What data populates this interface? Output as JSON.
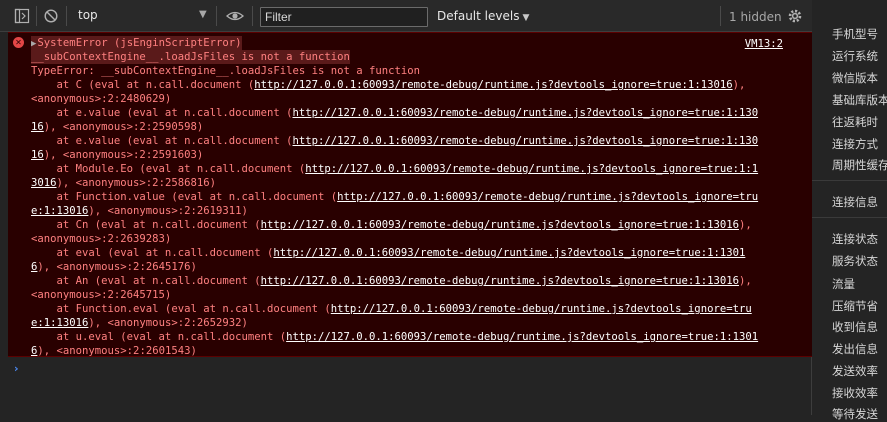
{
  "toolbar": {
    "context": "top",
    "filter_placeholder": "Filter",
    "levels": "Default levels",
    "hidden_count": "1 hidden"
  },
  "error": {
    "header1": "SystemError (jsEnginScriptError)",
    "header2": "__subContextEngine__.loadJsFiles is not a function",
    "source": "VM13:2",
    "type_line": "TypeError: __subContextEngine__.loadJsFiles is not a function",
    "lines": [
      {
        "pre": "    at C (eval at n.call.document (",
        "link": "http://127.0.0.1:60093/remote-debug/runtime.js?devtools_ignore=true:1:13016",
        "post": "),"
      },
      {
        "pre": "",
        "link": "",
        "post": "<anonymous>:2:2480629)"
      },
      {
        "pre": "    at e.value (eval at n.call.document (",
        "link": "http://127.0.0.1:60093/remote-debug/runtime.js?devtools_ignore=true:1:130",
        "post": ""
      },
      {
        "pre": "",
        "link": "16",
        "post": "), <anonymous>:2:2590598)"
      },
      {
        "pre": "    at e.value (eval at n.call.document (",
        "link": "http://127.0.0.1:60093/remote-debug/runtime.js?devtools_ignore=true:1:130",
        "post": ""
      },
      {
        "pre": "",
        "link": "16",
        "post": "), <anonymous>:2:2591603)"
      },
      {
        "pre": "    at Module.Eo (eval at n.call.document (",
        "link": "http://127.0.0.1:60093/remote-debug/runtime.js?devtools_ignore=true:1:1",
        "post": ""
      },
      {
        "pre": "",
        "link": "3016",
        "post": "), <anonymous>:2:2586816)"
      },
      {
        "pre": "    at Function.value (eval at n.call.document (",
        "link": "http://127.0.0.1:60093/remote-debug/runtime.js?devtools_ignore=tru",
        "post": ""
      },
      {
        "pre": "",
        "link": "e:1:13016",
        "post": "), <anonymous>:2:2619311)"
      },
      {
        "pre": "    at Cn (eval at n.call.document (",
        "link": "http://127.0.0.1:60093/remote-debug/runtime.js?devtools_ignore=true:1:13016",
        "post": "),"
      },
      {
        "pre": "",
        "link": "",
        "post": "<anonymous>:2:2639283)"
      },
      {
        "pre": "    at eval (eval at n.call.document (",
        "link": "http://127.0.0.1:60093/remote-debug/runtime.js?devtools_ignore=true:1:1301",
        "post": ""
      },
      {
        "pre": "",
        "link": "6",
        "post": "), <anonymous>:2:2645176)"
      },
      {
        "pre": "    at An (eval at n.call.document (",
        "link": "http://127.0.0.1:60093/remote-debug/runtime.js?devtools_ignore=true:1:13016",
        "post": "),"
      },
      {
        "pre": "",
        "link": "",
        "post": "<anonymous>:2:2645715)"
      },
      {
        "pre": "    at Function.eval (eval at n.call.document (",
        "link": "http://127.0.0.1:60093/remote-debug/runtime.js?devtools_ignore=tru",
        "post": ""
      },
      {
        "pre": "",
        "link": "e:1:13016",
        "post": "), <anonymous>:2:2652932)"
      },
      {
        "pre": "    at u.eval (eval at n.call.document (",
        "link": "http://127.0.0.1:60093/remote-debug/runtime.js?devtools_ignore=true:1:1301",
        "post": ""
      },
      {
        "pre": "",
        "link": "6",
        "post": "), <anonymous>:2:2601543)"
      }
    ]
  },
  "side_panel": {
    "items": [
      "手机型号",
      "运行系统",
      "微信版本",
      "基础库版本",
      "往返耗时",
      "连接方式",
      "周期性缓存",
      "连接信息",
      "连接状态",
      "服务状态",
      "流量",
      "压缩节省",
      "收到信息",
      "发出信息",
      "发送效率",
      "接收效率",
      "等待发送"
    ]
  },
  "colors": {
    "error_bg": "#290000",
    "error_text": "#ff8080",
    "link": "#ffffff",
    "prompt": "#4c8bf5"
  },
  "icons": [
    "sidebar-toggle-icon",
    "clear-console-icon",
    "eye-icon",
    "gear-icon",
    "error-icon",
    "expand-triangle-icon",
    "prompt-chevron-icon"
  ]
}
